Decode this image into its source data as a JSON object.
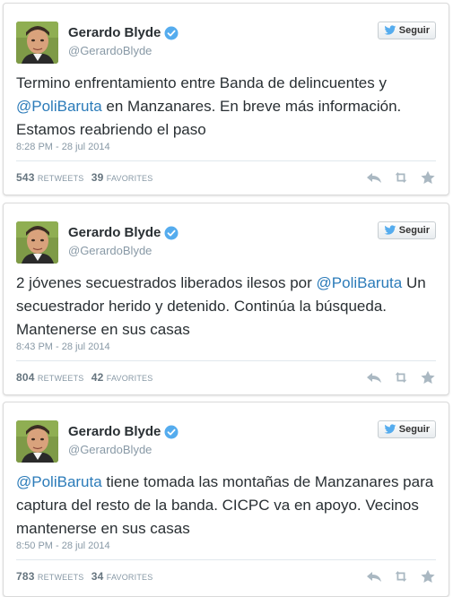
{
  "follow_label": "Seguir",
  "tweets": [
    {
      "name": "Gerardo Blyde",
      "handle": "@GerardoBlyde",
      "text_parts": [
        "Termino enfrentamiento entre Banda de delincuentes y ",
        "@PoliBaruta",
        " en Manzanares. En breve más información. Estamos reabriendo el paso"
      ],
      "time": "8:28 PM - 28 jul 2014",
      "retweets": "543",
      "retweets_label": "RETWEETS",
      "favorites": "39",
      "favorites_label": "FAVORITES"
    },
    {
      "name": "Gerardo Blyde",
      "handle": "@GerardoBlyde",
      "text_parts": [
        "2 jóvenes secuestrados liberados ilesos por ",
        "@PoliBaruta",
        " Un secuestrador herido y detenido. Continúa la búsqueda. Mantenerse en sus casas"
      ],
      "time": "8:43 PM - 28 jul 2014",
      "retweets": "804",
      "retweets_label": "RETWEETS",
      "favorites": "42",
      "favorites_label": "FAVORITES"
    },
    {
      "name": "Gerardo Blyde",
      "handle": "@GerardoBlyde",
      "text_parts": [
        "",
        "@PoliBaruta",
        " tiene tomada las montañas de Manzanares para captura del resto de la banda. CICPC va en apoyo. Vecinos mantenerse en sus casas"
      ],
      "time": "8:50 PM - 28 jul 2014",
      "retweets": "783",
      "retweets_label": "RETWEETS",
      "favorites": "34",
      "favorites_label": "FAVORITES"
    }
  ],
  "icons": {
    "verified": "verified-badge-icon",
    "bird": "twitter-bird-icon",
    "reply": "reply-icon",
    "retweet": "retweet-icon",
    "favorite": "favorite-star-icon"
  },
  "colors": {
    "mention": "#2b7bb9",
    "verified": "#55acee",
    "meta": "#8899a6"
  }
}
